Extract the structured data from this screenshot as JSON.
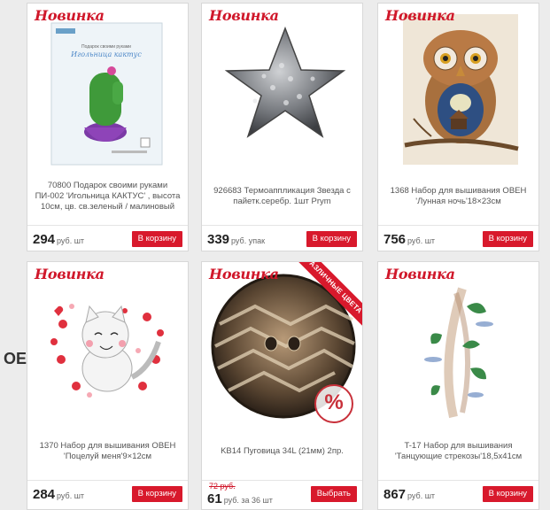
{
  "side_label": "ОЕ",
  "badge_text": "Новинка",
  "products": [
    {
      "name": "70800 Подарок своими руками ПИ-002 'Игольница КАКТУС' , высота 10см, цв. св.зеленый / малиновый",
      "price": "294",
      "unit": "руб. шт",
      "button": "В корзину"
    },
    {
      "name": "926683 Термоаппликация Звезда с пайетк.серебр. 1шт Prym",
      "price": "339",
      "unit": "руб. упак",
      "button": "В корзину"
    },
    {
      "name": "1368 Набор для вышивания ОВЕН 'Лунная ночь'18×23см",
      "price": "756",
      "unit": "руб. шт",
      "button": "В корзину"
    },
    {
      "name": "1370 Набор для вышивания ОВЕН 'Поцелуй меня'9×12см",
      "price": "284",
      "unit": "руб. шт",
      "button": "В корзину"
    },
    {
      "name": "KB14 Пуговица 34L (21мм) 2пр.",
      "old_price": "72 руб.",
      "price": "61",
      "unit": "руб. за 36 шт",
      "button": "Выбрать",
      "ribbon": "РАЗЛИЧНЫЕ ЦВЕТА"
    },
    {
      "name": "T-17 Набор для вышивания 'Танцующие стрекозы'18,5х41см",
      "price": "867",
      "unit": "руб. шт",
      "button": "В корзину"
    }
  ],
  "kit_box": {
    "top_text": "Подарок своими руками",
    "title": "Игольница кактус"
  }
}
